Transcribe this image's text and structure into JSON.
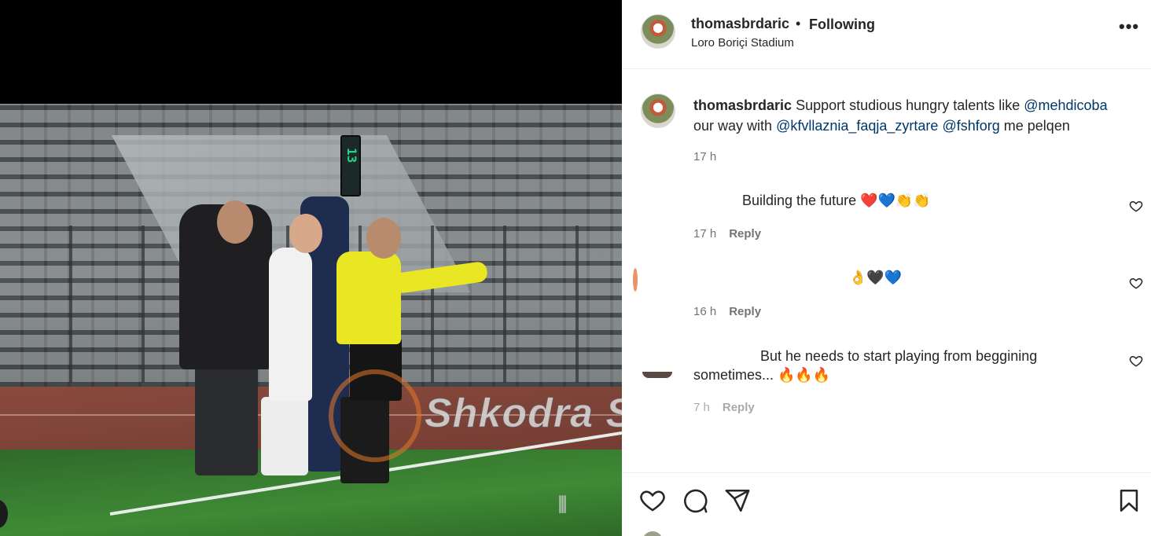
{
  "post": {
    "username": "thomasbrdaric",
    "separator": "•",
    "follow_status": "Following",
    "location": "Loro Boriçi Stadium"
  },
  "caption": {
    "username": "thomasbrdaric",
    "text_1": "Support studious hungry talents like",
    "mention_1": "@mehdicoba",
    "text_2": "our way with",
    "mention_2": "@kfvllaznia_faqja_zyrtare",
    "mention_3": "@fshforg",
    "text_3": "me pelqen",
    "time": "17 h"
  },
  "comments": [
    {
      "text": "Building the future ❤️💙👏👏",
      "time": "17 h",
      "reply_label": "Reply"
    },
    {
      "text": "👌🖤💙",
      "time": "16 h",
      "reply_label": "Reply"
    },
    {
      "text_line1": "But he needs to start playing from beggining",
      "text_line2": "sometimes... 🔥🔥🔥",
      "time": "7 h",
      "reply_label": "Reply"
    }
  ],
  "media": {
    "watermark": "Shkodra Sport",
    "board_number": "13"
  },
  "icons": {
    "more": "more-options-icon",
    "like": "heart-icon",
    "comment": "comment-icon",
    "share": "share-icon",
    "save": "bookmark-icon"
  },
  "colors": {
    "mention": "#00376b",
    "secondary_text": "#737373",
    "primary_text": "#262626"
  }
}
